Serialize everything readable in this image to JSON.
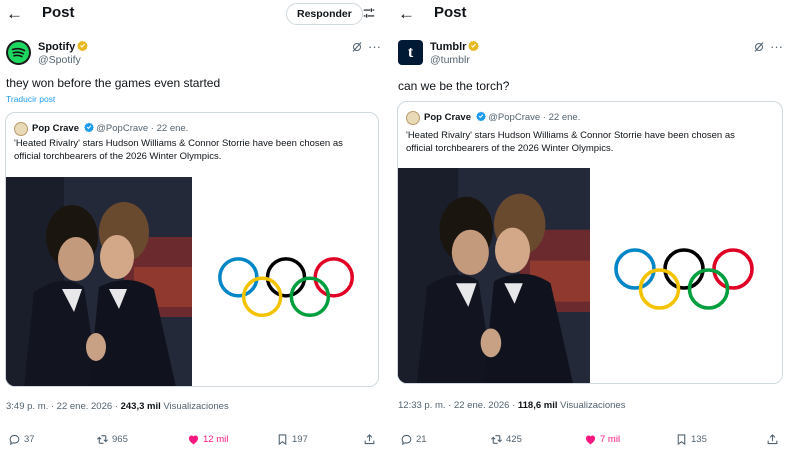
{
  "left": {
    "header_title": "Post",
    "reply_button": "Responder",
    "author_name": "Spotify",
    "author_handle": "@Spotify",
    "tweet_text": "they won before the games even started",
    "translate_link": "Traducir post",
    "quote": {
      "name": "Pop Crave",
      "handle_date": "@PopCrave · 22 ene.",
      "text_line1": "'Heated Rivalry' stars Hudson Williams & Connor Storrie have been chosen as",
      "text_line2": "official torchbearers of the 2026 Winter Olympics."
    },
    "timestamp": "3:49 p. m. · 22 ene. 2026 · ",
    "views_count": "243,3 mil",
    "views_label": " Visualizaciones",
    "replies": "37",
    "reposts": "965",
    "likes": "12 mil",
    "bookmarks": "197"
  },
  "right": {
    "header_title": "Post",
    "author_name": "Tumblr",
    "author_handle": "@tumblr",
    "avatar_letter": "t",
    "tweet_text": "can we be the torch?",
    "quote": {
      "name": "Pop Crave",
      "handle_date": "@PopCrave · 22 ene.",
      "text_line1": "'Heated Rivalry' stars Hudson Williams & Connor Storrie have been chosen as",
      "text_line2": "official torchbearers of the 2026 Winter Olympics."
    },
    "timestamp": "12:33 p. m. · 22 ene. 2026 · ",
    "views_count": "118,6 mil",
    "views_label": " Visualizaciones",
    "replies": "21",
    "reposts": "425",
    "likes": "7 mil",
    "bookmarks": "135"
  },
  "colors": {
    "like_pink": "#f91880",
    "link_blue": "#1d9bf0",
    "verified_gold": "#e8b821",
    "ring_blue": "#0085c7",
    "ring_yellow": "#f4c300",
    "ring_black": "#000000",
    "ring_green": "#009f3d",
    "ring_red": "#df0024"
  }
}
